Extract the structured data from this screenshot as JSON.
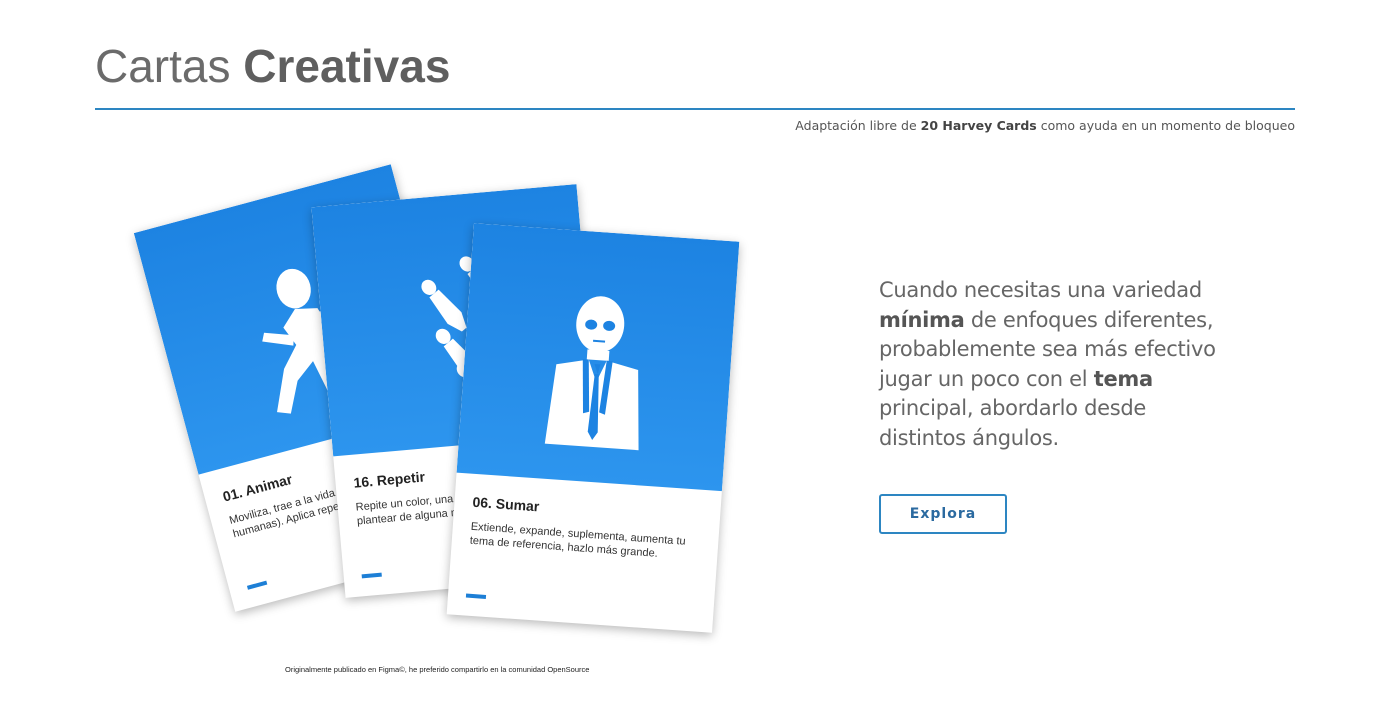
{
  "header": {
    "title_light": "Cartas",
    "title_bold": "Creativas",
    "subtitle_prefix": "Adaptación libre de",
    "subtitle_bold": "20 Harvey Cards",
    "subtitle_suffix": "como ayuda en un momento de bloqueo"
  },
  "cards": [
    {
      "title": "01. Animar",
      "text": "Moviliza, trae a la vida (infunde cualidades humanas). Aplica repetición, progresión.",
      "icon": "running-figure-icon"
    },
    {
      "title": "16. Repetir",
      "text": "Repite un color, una forma, una idea. Vuelve a plantear de alguna manera.",
      "icon": "flying-figures-icon"
    },
    {
      "title": "06. Sumar",
      "text": "Extiende, expande, suplementa, aumenta tu tema de referencia, hazlo más grande.",
      "icon": "suited-figure-icon"
    }
  ],
  "pitch": {
    "p1": "Cuando necesitas una variedad",
    "b1": "mínima",
    "p2": "de enfoques diferentes, probablemente sea más efectivo jugar un poco con el",
    "b2": "tema",
    "p3": "principal, abordarlo desde distintos ángulos."
  },
  "cta": {
    "label": "Explora"
  },
  "footnote": "Originalmente publicado en Figma©, he preferido compartirlo en la comunidad OpenSource",
  "colors": {
    "accent": "#2d86c2",
    "card_blue": "#1d83e2",
    "text_gray": "#666666"
  }
}
